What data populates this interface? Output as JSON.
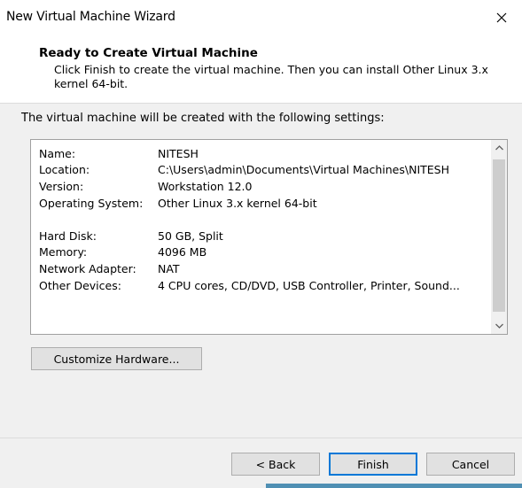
{
  "window": {
    "title": "New Virtual Machine Wizard"
  },
  "header": {
    "title": "Ready to Create Virtual Machine",
    "description": "Click Finish to create the virtual machine. Then you can install Other Linux 3.x kernel 64-bit."
  },
  "content": {
    "intro": "The virtual machine will be created with the following settings:",
    "settings": [
      {
        "key": "Name:",
        "value": "NITESH"
      },
      {
        "key": "Location:",
        "value": "C:\\Users\\admin\\Documents\\Virtual Machines\\NITESH"
      },
      {
        "key": "Version:",
        "value": "Workstation 12.0"
      },
      {
        "key": "Operating System:",
        "value": "Other Linux 3.x kernel 64-bit"
      },
      {
        "key": "",
        "value": ""
      },
      {
        "key": "Hard Disk:",
        "value": "50 GB, Split"
      },
      {
        "key": "Memory:",
        "value": "4096 MB"
      },
      {
        "key": "Network Adapter:",
        "value": "NAT"
      },
      {
        "key": "Other Devices:",
        "value": "4 CPU cores, CD/DVD, USB Controller, Printer, Sound..."
      }
    ],
    "customize_label": "Customize Hardware..."
  },
  "footer": {
    "back_label": "< Back",
    "finish_label": "Finish",
    "cancel_label": "Cancel"
  },
  "colors": {
    "accent": "#0078d7",
    "panel_bg": "#f0f0f0",
    "button_bg": "#e1e1e1"
  }
}
